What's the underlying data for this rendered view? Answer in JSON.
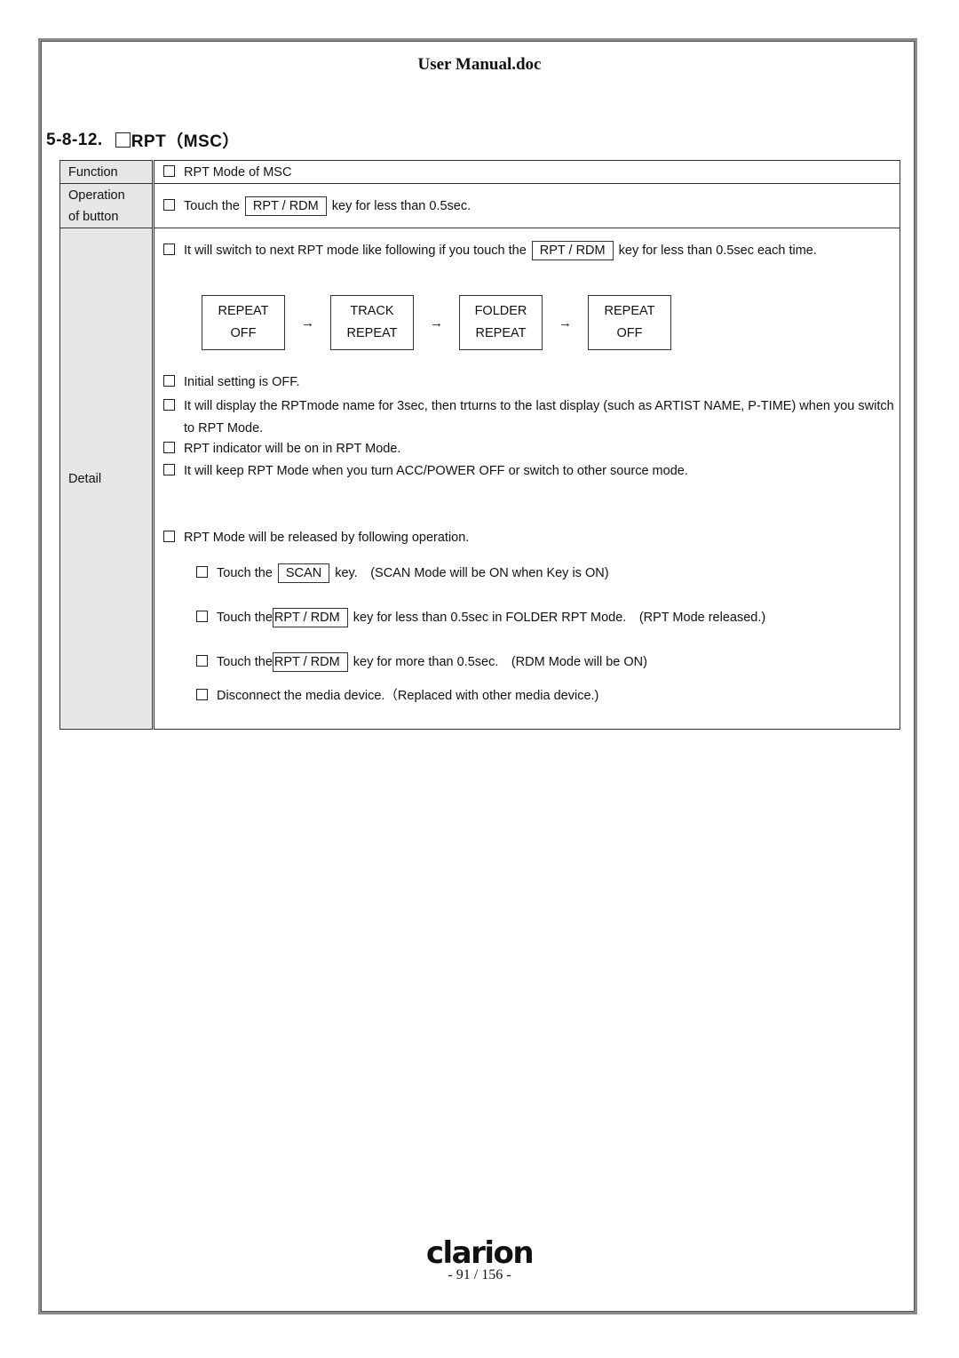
{
  "header": {
    "title": "User Manual.doc"
  },
  "section": {
    "number": "5-8-12.",
    "title": "RPT（MSC）"
  },
  "table": {
    "function": {
      "label": "Function",
      "text": "RPT Mode of MSC"
    },
    "operation": {
      "label_line1": "Operation",
      "label_line2": "of button",
      "prefix": "Touch the",
      "key": "RPT / RDM",
      "suffix": "key for less than 0.5sec."
    },
    "detail": {
      "label": "Detail",
      "intro": {
        "prefix": "It will switch to next RPT mode like following if you touch the",
        "key": "RPT / RDM",
        "suffix": "key for less than 0.5sec each time."
      },
      "flow": [
        {
          "line1": "REPEAT",
          "line2": "OFF"
        },
        {
          "line1": "TRACK",
          "line2": "REPEAT"
        },
        {
          "line1": "FOLDER",
          "line2": "REPEAT"
        },
        {
          "line1": "REPEAT",
          "line2": "OFF"
        }
      ],
      "arrow": "→",
      "notes": [
        "Initial setting is OFF.",
        "It will display the RPTmode name for 3sec, then trturns to the last display (such as ARTIST NAME, P-TIME) when you switch to RPT Mode.",
        "RPT indicator will be on in RPT Mode.",
        "It will keep RPT Mode when you turn ACC/POWER OFF or switch to other source mode."
      ],
      "release": {
        "heading": "RPT Mode will be released by following operation.",
        "items": [
          {
            "prefix": "Touch the",
            "key": "SCAN",
            "suffix": "key.　(SCAN Mode will be ON when Key is ON)"
          },
          {
            "prefix": "Touch the",
            "key": "RPT / RDM",
            "suffix": "key for less than 0.5sec in FOLDER RPT Mode.　(RPT Mode released.)"
          },
          {
            "prefix": "Touch the",
            "key": "RPT / RDM",
            "suffix": "key for more than 0.5sec.　(RDM Mode will be ON)"
          },
          {
            "text": "Disconnect the media device.（Replaced with other media device.)"
          }
        ]
      }
    }
  },
  "footer": {
    "logo": "clarion",
    "page": "- 91 / 156 -"
  }
}
